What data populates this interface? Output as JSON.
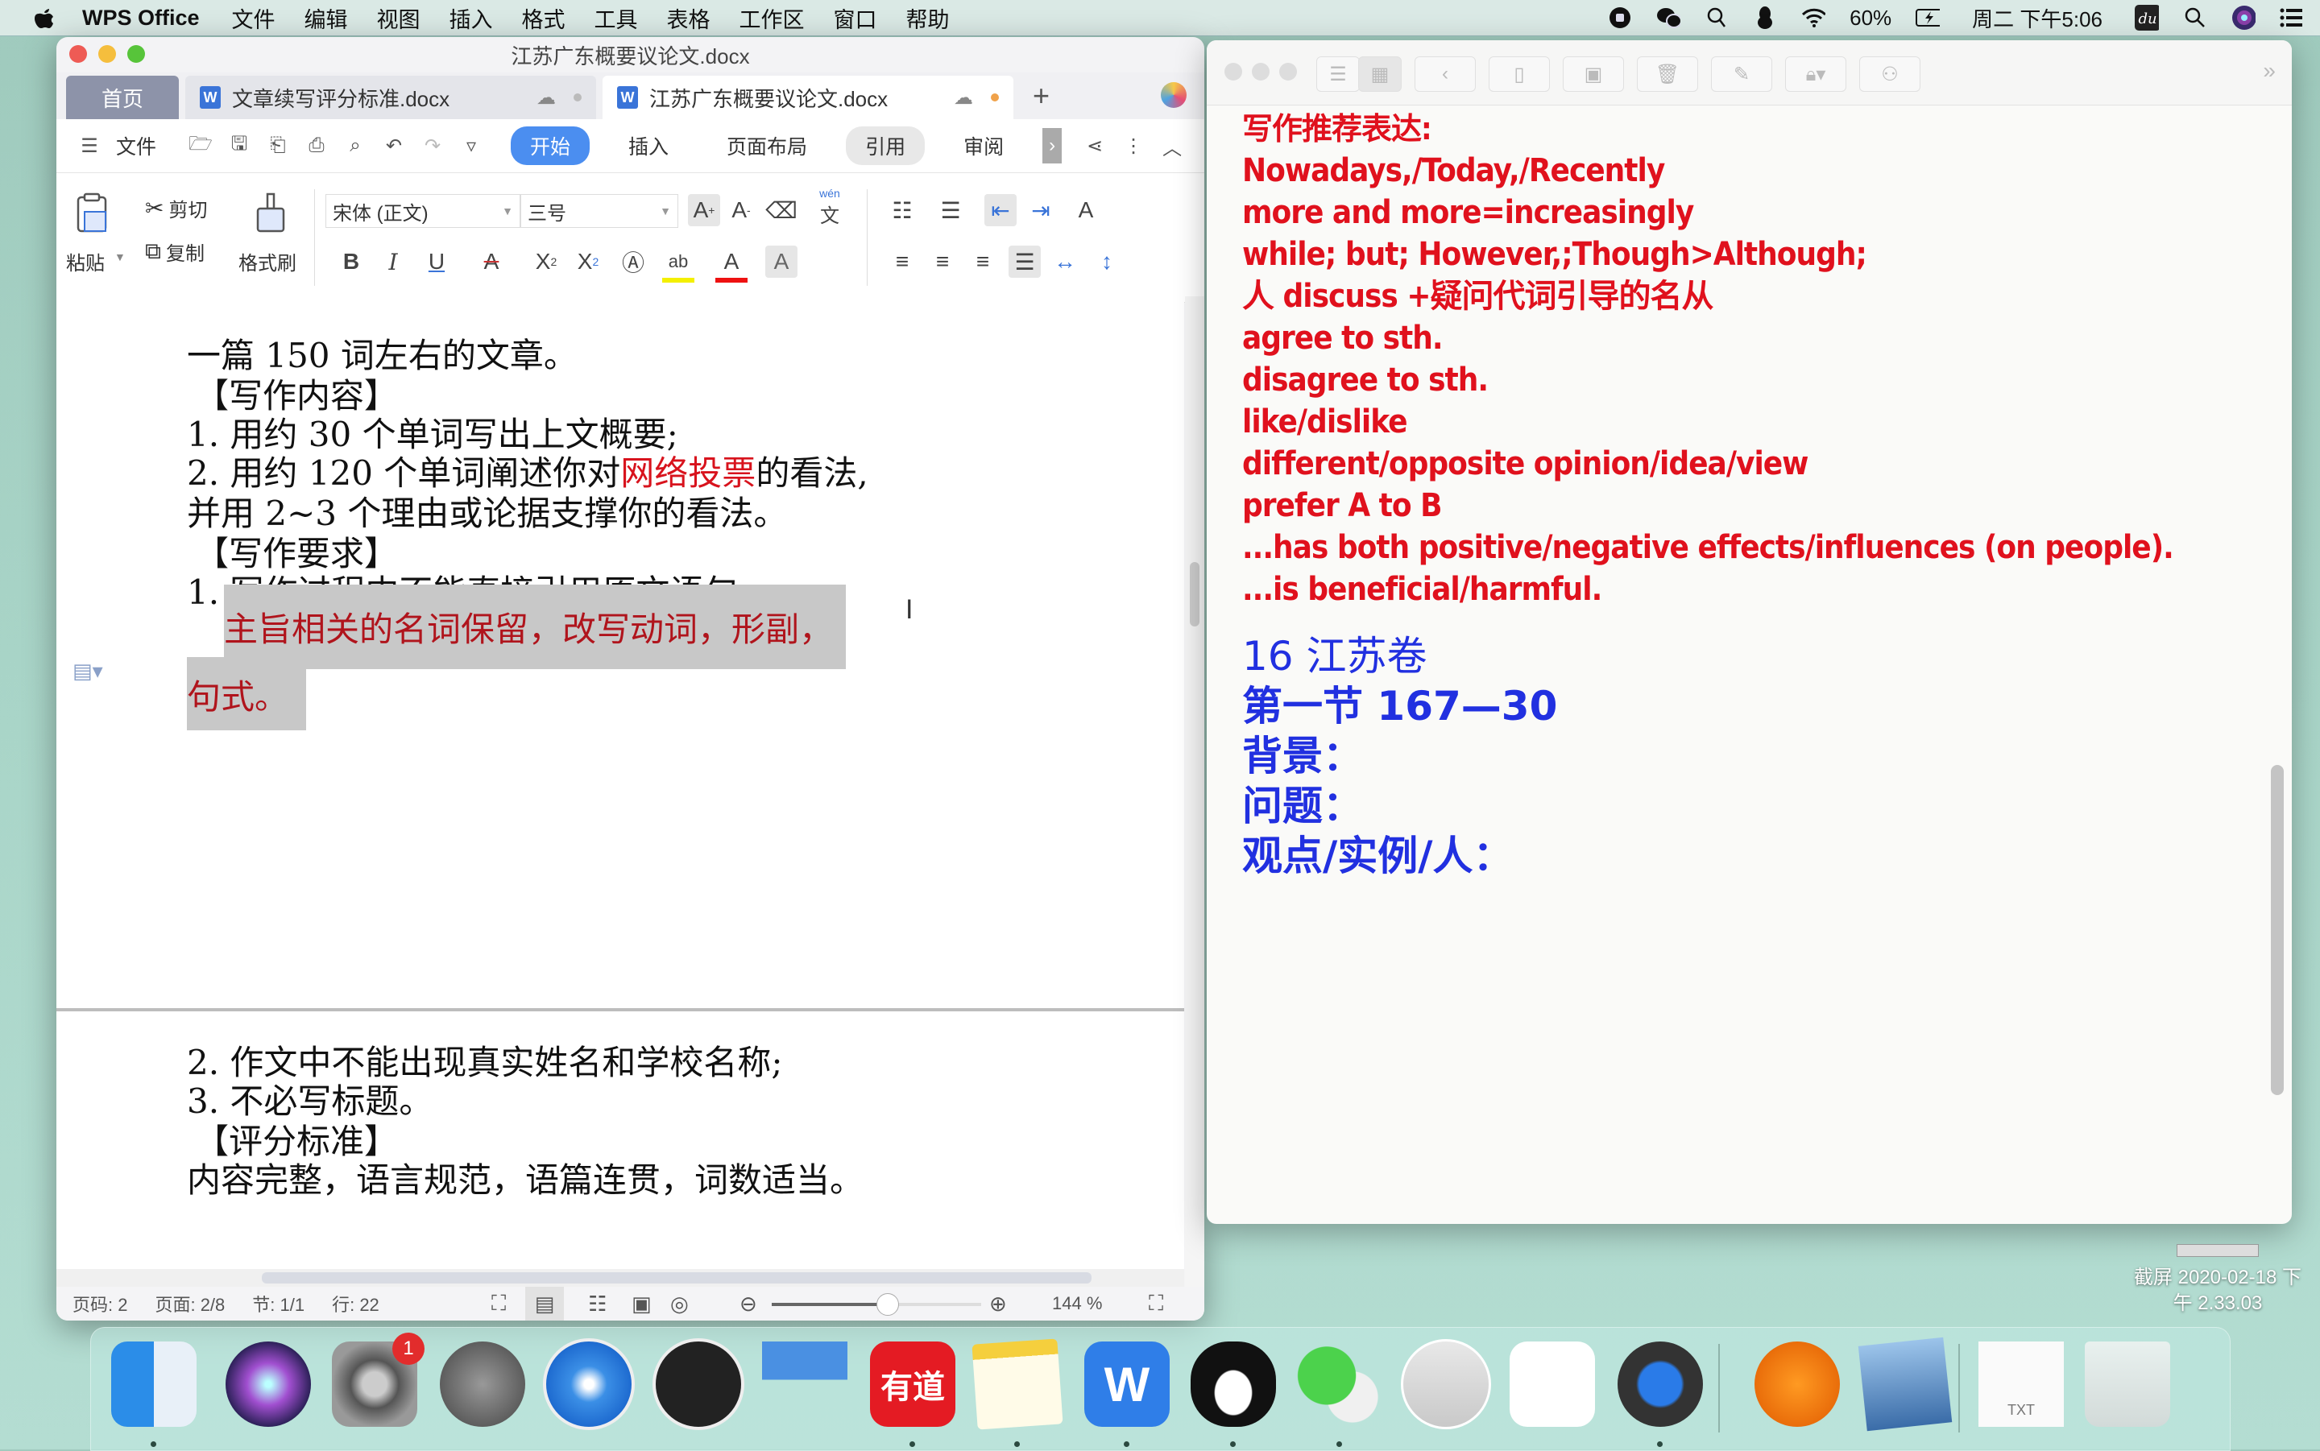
{
  "menubar": {
    "app_name": "WPS Office",
    "items": [
      "文件",
      "编辑",
      "视图",
      "插入",
      "格式",
      "工具",
      "表格",
      "工作区",
      "窗口",
      "帮助"
    ],
    "battery": "60%",
    "clock": "周二 下午5:06",
    "status_icons": [
      "screen-record-icon",
      "wechat-icon",
      "search-doc-icon",
      "qq-icon",
      "wifi-icon",
      "battery-charging-icon",
      "baidu-du-icon",
      "spotlight-icon",
      "siri-icon",
      "notification-center-icon"
    ]
  },
  "wps": {
    "window_title": "江苏广东概要议论文.docx",
    "tabs": [
      {
        "label": "首页"
      },
      {
        "label": "文章续写评分标准.docx"
      },
      {
        "label": "江苏广东概要议论文.docx"
      }
    ],
    "menu_row": {
      "file": "文件",
      "ribbon_tabs": [
        "开始",
        "插入",
        "页面布局",
        "引用",
        "审阅"
      ],
      "active_tab": "开始"
    },
    "ribbon": {
      "paste": "粘贴",
      "cut": "剪切",
      "copy": "复制",
      "format_painter": "格式刷",
      "font_name": "宋体 (正文)",
      "font_size": "三号",
      "pinyin_label": "wén"
    },
    "document": {
      "lines": [
        {
          "text": "一篇 150 词左右的文章。"
        },
        {
          "text": "【写作内容】"
        },
        {
          "text": "1.  用约 30 个单词写出上文概要;"
        },
        {
          "pre": "2.  用约 120 个单词阐述你对",
          "red": "网络投票",
          "post": "的看法,"
        },
        {
          "text": "并用 2~3 个理由或论据支撑你的看法。"
        },
        {
          "text": "【写作要求】"
        },
        {
          "text": "1.  写作过程中不能直接引用原文语句;"
        },
        {
          "selected1": "主旨相关的名词保留，改写动词，形副，"
        },
        {
          "selected2": "句式。"
        },
        {
          "text": "2.  作文中不能出现真实姓名和学校名称;"
        },
        {
          "text": "3.  不必写标题。"
        },
        {
          "text": "【评分标准】"
        },
        {
          "text": "内容完整，语言规范，语篇连贯，词数适当。"
        }
      ]
    },
    "statusbar": {
      "page_num": "页码: 2",
      "page": "页面: 2/8",
      "section": "节: 1/1",
      "line": "行: 22",
      "zoom": "144 %",
      "zoom_fraction": 0.55
    }
  },
  "notes": {
    "red_lines": [
      "写作推荐表达:",
      "Nowadays,/Today,/Recently",
      "more and more=increasingly",
      "while; but; However,;Though>Although;",
      "人 discuss +疑问代词引导的名从",
      "agree to sth.",
      "disagree to sth.",
      "like/dislike",
      "different/opposite opinion/idea/view",
      "prefer A to B",
      "...has both positive/negative effects/influences (on people).",
      "...is beneficial/harmful."
    ],
    "blue_lines": [
      "16 江苏卷",
      "第一节 167—30",
      "背景：",
      "问题：",
      "观点/实例/人："
    ],
    "colors": {
      "red": "#e0111d",
      "blue": "#2130e0"
    }
  },
  "desktop": {
    "screenshot_label_1": "截屏 2020-02-18 下",
    "screenshot_label_2": "午 2.33.03"
  },
  "dock": {
    "apps": [
      {
        "name": "finder"
      },
      {
        "name": "siri"
      },
      {
        "name": "system-preferences",
        "badge": "1"
      },
      {
        "name": "launchpad"
      },
      {
        "name": "safari"
      },
      {
        "name": "obs"
      },
      {
        "name": "keynote"
      },
      {
        "name": "youdao",
        "label": "有道"
      },
      {
        "name": "notes"
      },
      {
        "name": "wps-office",
        "label": "W"
      },
      {
        "name": "qq"
      },
      {
        "name": "wechat"
      },
      {
        "name": "image-capture"
      },
      {
        "name": "baidu-netdisk"
      },
      {
        "name": "quicktime"
      },
      {
        "name": "books"
      },
      {
        "name": "preview"
      },
      {
        "name": "txt-file",
        "label": "TXT"
      },
      {
        "name": "trash"
      }
    ]
  }
}
